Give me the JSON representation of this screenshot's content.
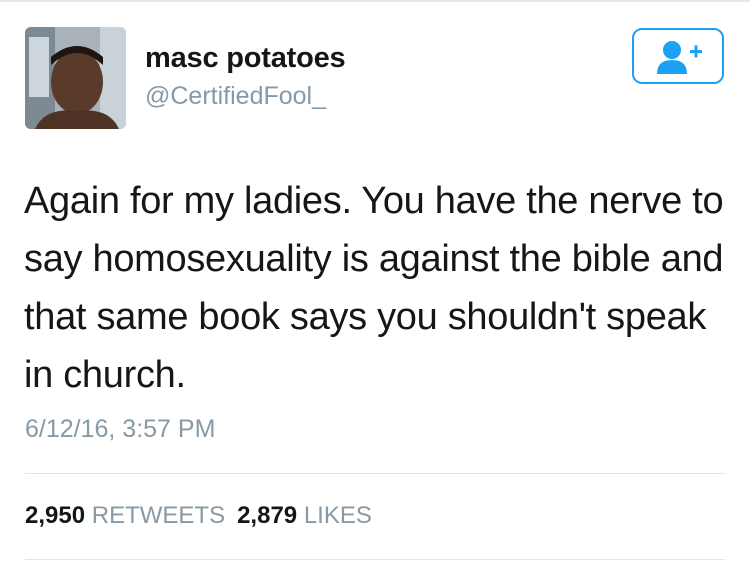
{
  "user": {
    "display_name": "masc potatoes",
    "handle": "@CertifiedFool_",
    "avatar_icon": "profile-photo"
  },
  "follow_button": {
    "icon": "add-user-icon",
    "color": "#1da1f2"
  },
  "tweet": {
    "text": "Again for my ladies. You have the nerve to say homosexuality is against the bible and that same book says you shouldn't speak in church.",
    "timestamp": "6/12/16, 3:57 PM"
  },
  "stats": {
    "retweets_count": "2,950",
    "retweets_label": "RETWEETS",
    "likes_count": "2,879",
    "likes_label": "LIKES"
  }
}
